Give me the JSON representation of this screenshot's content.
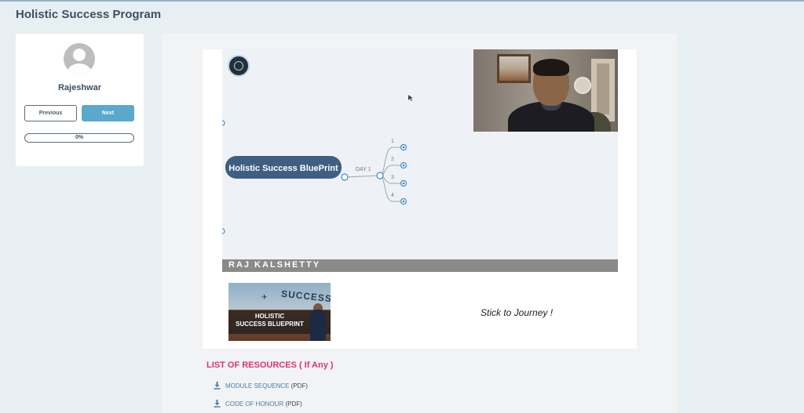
{
  "page": {
    "title": "Holistic Success Program"
  },
  "profile": {
    "name": "Rajeshwar",
    "previous_label": "Previous",
    "next_label": "Next",
    "progress_text": "0%",
    "progress_value": 0
  },
  "video": {
    "central_node": "Holistic Success BluePrint",
    "branch_label": "DAY 1",
    "sub_nodes": [
      "1",
      "2",
      "3",
      "4"
    ],
    "presenter_banner": "RAJ KALSHETTY"
  },
  "promo": {
    "thumb_word": "SUCCESS",
    "thumb_line1": "HOLISTIC",
    "thumb_line2": "SUCCESS BLUEPRINT",
    "quote": "Stick to Journey !"
  },
  "resources": {
    "heading": "LIST OF RESOURCES ( If Any )",
    "items": [
      {
        "label": "MODULE SEQUENCE",
        "type": "(PDF)"
      },
      {
        "label": "CODE OF HONOUR",
        "type": "(PDF)"
      }
    ]
  },
  "colors": {
    "accent": "#5aa8cc",
    "node_fill": "#3f5f82",
    "heading_pink": "#e0326e",
    "link_blue": "#4d7ea3"
  }
}
